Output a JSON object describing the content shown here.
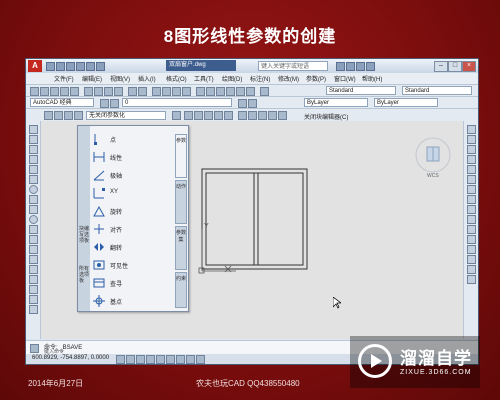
{
  "slide": {
    "title": "8图形线性参数的创建",
    "date": "2014年6月27日",
    "author": "农夫也玩CAD QQ438550480"
  },
  "watermark": {
    "brand": "溜溜自学",
    "url": "ZIXUE.3D66.COM"
  },
  "app": {
    "document_title": "双扇窗户.dwg",
    "search_placeholder": "键入关键字或短语",
    "workspace": "AutoCAD 经典",
    "layer_value": "0",
    "text_style": "Standard",
    "dim_style": "Standard",
    "color_value": "ByLayer",
    "linetype_value": "ByLayer",
    "constraint_combo": "无关闭参数化",
    "close_editor": "关闭块编辑器(C)",
    "menus": [
      "文件(F)",
      "编辑(E)",
      "视图(V)",
      "插入(I)",
      "格式(O)",
      "工具(T)",
      "绘图(D)",
      "标注(N)",
      "修改(M)",
      "参数(P)",
      "窗口(W)",
      "帮助(H)"
    ],
    "wcs_label": "WCS",
    "y_axis_label": "Y"
  },
  "palette": {
    "side_labels": [
      "块编写选项板",
      "所有选项板"
    ],
    "items": [
      {
        "label": "点",
        "icon": "point-param-icon"
      },
      {
        "label": "线性",
        "icon": "linear-param-icon"
      },
      {
        "label": "极轴",
        "icon": "polar-param-icon"
      },
      {
        "label": "XY",
        "icon": "xy-param-icon"
      },
      {
        "label": "旋转",
        "icon": "rotation-param-icon"
      },
      {
        "label": "对齐",
        "icon": "align-param-icon"
      },
      {
        "label": "翻转",
        "icon": "flip-param-icon"
      },
      {
        "label": "可见性",
        "icon": "visibility-param-icon"
      },
      {
        "label": "查寻",
        "icon": "lookup-param-icon"
      },
      {
        "label": "基点",
        "icon": "basepoint-param-icon"
      }
    ],
    "tabs": [
      "参数",
      "动作",
      "参数集",
      "约束"
    ]
  },
  "command": {
    "history": "命令: _BSAVE",
    "prompt": "键入命令"
  },
  "status": {
    "coords": "600.8929, -754.8897, 0.0000"
  },
  "colors": {
    "slide_bg": "#7d1010",
    "app_chrome": "#dfe6ef",
    "canvas": "#e2e2e2"
  }
}
